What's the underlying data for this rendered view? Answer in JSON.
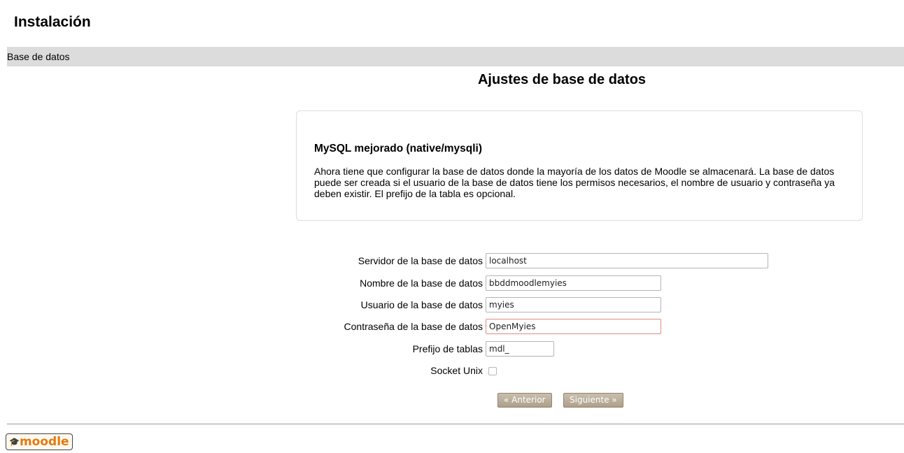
{
  "header": {
    "title": "Instalación"
  },
  "navbar": {
    "breadcrumb": "Base de datos"
  },
  "main": {
    "title": "Ajustes de base de datos",
    "info": {
      "db_title": "MySQL mejorado (native/mysqli)",
      "description": "Ahora tiene que configurar la base de datos donde la mayoría de los datos de Moodle se almacenará. La base de datos puede ser creada si el usuario de la base de datos tiene los permisos necesarios, el nombre de usuario y contraseña ya deben existir. El prefijo de la tabla es opcional."
    },
    "form": {
      "dbhost": {
        "label": "Servidor de la base de datos",
        "value": "localhost"
      },
      "dbname": {
        "label": "Nombre de la base de datos",
        "value": "bbddmoodlemyies"
      },
      "dbuser": {
        "label": "Usuario de la base de datos",
        "value": "myies"
      },
      "dbpass": {
        "label": "Contraseña de la base de datos",
        "value": "OpenMyies"
      },
      "prefix": {
        "label": "Prefijo de tablas",
        "value": "mdl_"
      },
      "socket": {
        "label": "Socket Unix",
        "checked": false
      }
    },
    "buttons": {
      "previous": "« Anterior",
      "next": "Siguiente »"
    }
  },
  "footer": {
    "logo_text": "moodle",
    "logo_icon": "graduation-cap-icon"
  }
}
